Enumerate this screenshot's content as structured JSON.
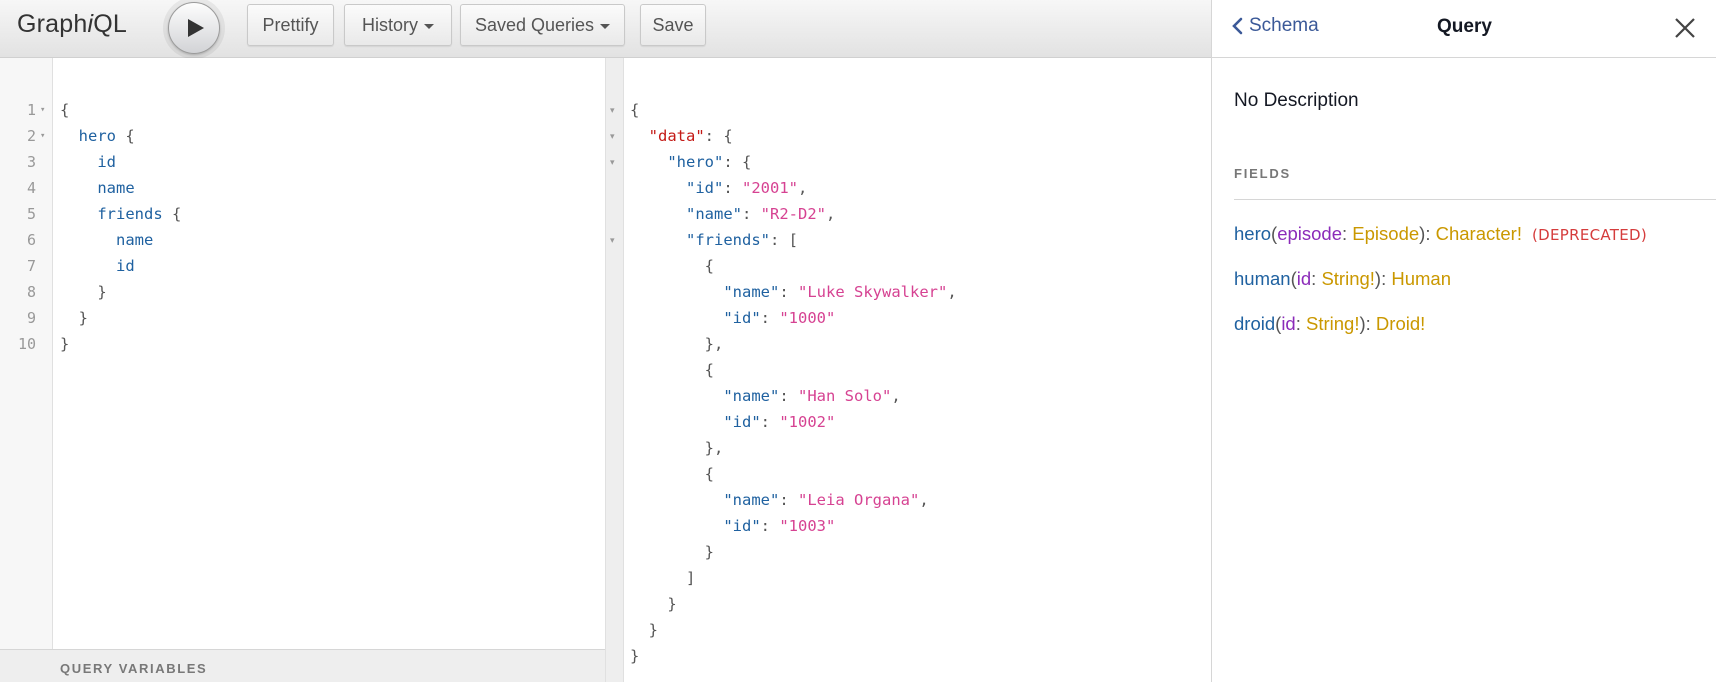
{
  "toolbar": {
    "logo_prefix": "Graph",
    "logo_italic": "i",
    "logo_suffix": "QL",
    "prettify_label": "Prettify",
    "history_label": "History",
    "saved_queries_label": "Saved Queries",
    "save_label": "Save"
  },
  "query_editor": {
    "line_numbers": [
      "1",
      "2",
      "3",
      "4",
      "5",
      "6",
      "7",
      "8",
      "9",
      "10"
    ],
    "lines": [
      {
        "indent": "",
        "field": "",
        "punc": "{"
      },
      {
        "indent": "  ",
        "field": "hero",
        "punc": " {"
      },
      {
        "indent": "    ",
        "field": "id",
        "punc": ""
      },
      {
        "indent": "    ",
        "field": "name",
        "punc": ""
      },
      {
        "indent": "    ",
        "field": "friends",
        "punc": " {"
      },
      {
        "indent": "      ",
        "field": "name",
        "punc": ""
      },
      {
        "indent": "      ",
        "field": "id",
        "punc": ""
      },
      {
        "indent": "    ",
        "field": "",
        "punc": "}"
      },
      {
        "indent": "  ",
        "field": "",
        "punc": "}"
      },
      {
        "indent": "",
        "field": "",
        "punc": "}"
      }
    ],
    "variables_title": "QUERY VARIABLES"
  },
  "result": {
    "lines": [
      {
        "indent": "",
        "key": "",
        "sep": "",
        "val": "",
        "tail": "{"
      },
      {
        "indent": "  ",
        "key": "\"data\"",
        "sep": ": ",
        "val": "",
        "tail": "{"
      },
      {
        "indent": "    ",
        "key": "\"hero\"",
        "sep": ": ",
        "val": "",
        "tail": "{"
      },
      {
        "indent": "      ",
        "key": "\"id\"",
        "sep": ": ",
        "val": "\"2001\"",
        "tail": ","
      },
      {
        "indent": "      ",
        "key": "\"name\"",
        "sep": ": ",
        "val": "\"R2-D2\"",
        "tail": ","
      },
      {
        "indent": "      ",
        "key": "\"friends\"",
        "sep": ": ",
        "val": "",
        "tail": "["
      },
      {
        "indent": "        ",
        "key": "",
        "sep": "",
        "val": "",
        "tail": "{"
      },
      {
        "indent": "          ",
        "key": "\"name\"",
        "sep": ": ",
        "val": "\"Luke Skywalker\"",
        "tail": ","
      },
      {
        "indent": "          ",
        "key": "\"id\"",
        "sep": ": ",
        "val": "\"1000\"",
        "tail": ""
      },
      {
        "indent": "        ",
        "key": "",
        "sep": "",
        "val": "",
        "tail": "},"
      },
      {
        "indent": "        ",
        "key": "",
        "sep": "",
        "val": "",
        "tail": "{"
      },
      {
        "indent": "          ",
        "key": "\"name\"",
        "sep": ": ",
        "val": "\"Han Solo\"",
        "tail": ","
      },
      {
        "indent": "          ",
        "key": "\"id\"",
        "sep": ": ",
        "val": "\"1002\"",
        "tail": ""
      },
      {
        "indent": "        ",
        "key": "",
        "sep": "",
        "val": "",
        "tail": "},"
      },
      {
        "indent": "        ",
        "key": "",
        "sep": "",
        "val": "",
        "tail": "{"
      },
      {
        "indent": "          ",
        "key": "\"name\"",
        "sep": ": ",
        "val": "\"Leia Organa\"",
        "tail": ","
      },
      {
        "indent": "          ",
        "key": "\"id\"",
        "sep": ": ",
        "val": "\"1003\"",
        "tail": ""
      },
      {
        "indent": "        ",
        "key": "",
        "sep": "",
        "val": "",
        "tail": "}"
      },
      {
        "indent": "      ",
        "key": "",
        "sep": "",
        "val": "",
        "tail": "]"
      },
      {
        "indent": "    ",
        "key": "",
        "sep": "",
        "val": "",
        "tail": "}"
      },
      {
        "indent": "  ",
        "key": "",
        "sep": "",
        "val": "",
        "tail": "}"
      },
      {
        "indent": "",
        "key": "",
        "sep": "",
        "val": "",
        "tail": "}"
      }
    ]
  },
  "docs": {
    "back_label": "Schema",
    "title": "Query",
    "description": "No Description",
    "fields_title": "FIELDS",
    "fields": [
      {
        "name": "hero",
        "open": "(",
        "arg": "episode",
        "colon1": ": ",
        "arg_type": "Episode",
        "close": "): ",
        "return_type": "Character!",
        "deprecated": "(DEPRECATED)"
      },
      {
        "name": "human",
        "open": "(",
        "arg": "id",
        "colon1": ": ",
        "arg_type": "String!",
        "close": "): ",
        "return_type": "Human",
        "deprecated": ""
      },
      {
        "name": "droid",
        "open": "(",
        "arg": "id",
        "colon1": ": ",
        "arg_type": "String!",
        "close": "): ",
        "return_type": "Droid!",
        "deprecated": ""
      }
    ]
  },
  "colors": {
    "field": "#1f61a0",
    "json_key_top": "#c41a16",
    "string": "#d64292",
    "arg": "#8b2bb9",
    "type": "#ca9800",
    "deprecated": "#d53c3c"
  },
  "icons": {
    "execute": "play-icon",
    "back": "chevron-left-icon",
    "close": "close-icon",
    "fold": "triangle-down-icon"
  }
}
